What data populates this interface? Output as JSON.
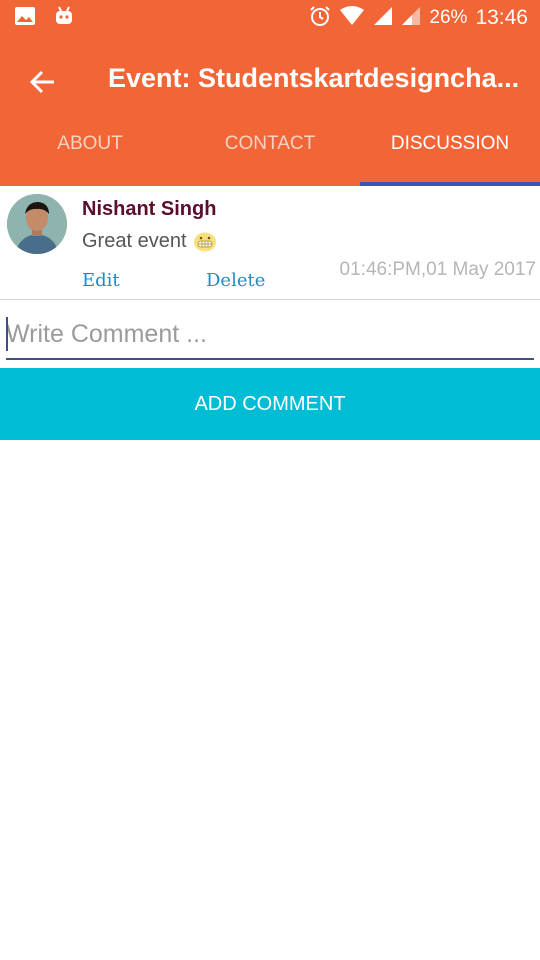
{
  "status_bar": {
    "battery": "26%",
    "time": "13:46",
    "icons": [
      "gallery-icon",
      "android-icon",
      "alarm-icon",
      "wifi-icon",
      "signal-icon",
      "signal-icon-2"
    ]
  },
  "app_bar": {
    "back_icon": "back-arrow-icon",
    "title": "Event: Studentskartdesigncha..."
  },
  "tabs": [
    {
      "label": "ABOUT",
      "active": false
    },
    {
      "label": "CONTACT",
      "active": false
    },
    {
      "label": "DISCUSSION",
      "active": true
    }
  ],
  "comments": [
    {
      "author": "Nishant Singh",
      "text": "Great event",
      "emoji": "grinning-face-emoji",
      "edit_label": "Edit",
      "delete_label": "Delete",
      "timestamp": "01:46:PM,01 May 2017"
    }
  ],
  "comment_input": {
    "value": "",
    "placeholder": "Write Comment ..."
  },
  "add_comment_button": "ADD COMMENT",
  "colors": {
    "primary": "#f26537",
    "tab_indicator": "#3f51b5",
    "button": "#00bcd4",
    "author": "#5a0d2e",
    "link": "#1f8ac6"
  }
}
